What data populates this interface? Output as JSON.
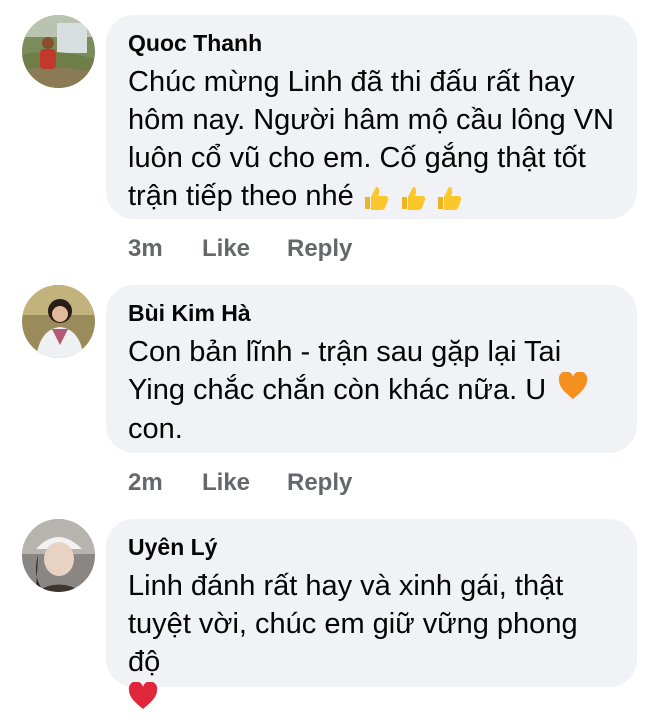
{
  "comments": [
    {
      "author": "Quoc Thanh",
      "text": "Chúc mừng Linh đã thi đấu rất hay hôm nay. Người hâm mộ cầu lông VN luôn cổ vũ cho em. Cố gắng thật tốt trận tiếp theo nhé",
      "time": "3m",
      "like_label": "Like",
      "reply_label": "Reply",
      "emoji": [
        "thumbs-up-icon",
        "thumbs-up-icon",
        "thumbs-up-icon"
      ]
    },
    {
      "author": "Bùi Kim Hà",
      "text_line1": "Con bản lĩnh - trận sau gặp lại Tai",
      "text_line2": "Ying chắc chắn còn khác nữa. U",
      "text_line3": "con.",
      "time": "2m",
      "like_label": "Like",
      "reply_label": "Reply",
      "emoji": [
        "orange-heart-icon"
      ]
    },
    {
      "author": "Uyên Lý",
      "text_line1": "Linh đánh rất hay và xinh gái, thật",
      "text_line2": "tuyệt vời, chúc em giữ vững phong độ",
      "emoji": [
        "red-heart-icon"
      ]
    }
  ],
  "colors": {
    "bubble_bg": "#f0f2f5",
    "meta_text": "#65676b",
    "text": "#050505"
  }
}
